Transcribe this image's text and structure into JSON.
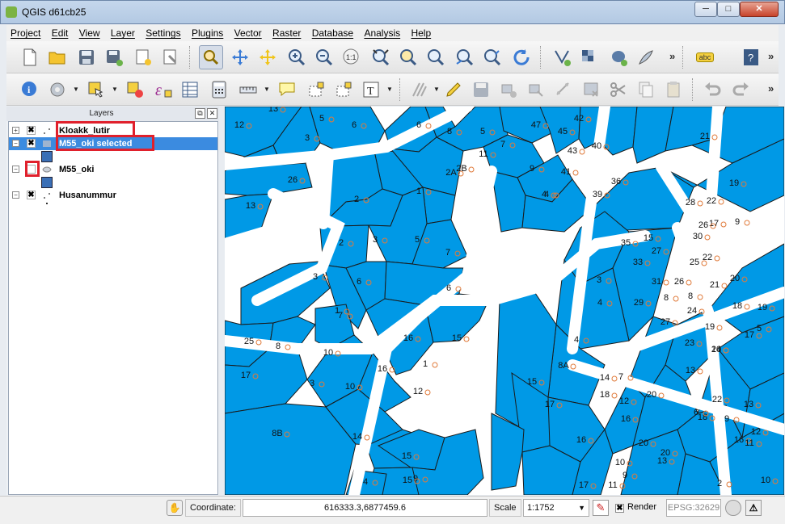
{
  "window": {
    "title": "QGIS d61cb25",
    "minimize": "─",
    "maximize": "□",
    "close": "✕"
  },
  "menubar": {
    "items": [
      "Project",
      "Edit",
      "View",
      "Layer",
      "Settings",
      "Plugins",
      "Vector",
      "Raster",
      "Database",
      "Analysis",
      "Help"
    ]
  },
  "toolbar1": {
    "buttons": [
      "new-project-icon",
      "open-project-icon",
      "save-project-icon",
      "save-as-icon",
      "new-print-composer-icon",
      "composer-manager-icon",
      "pan-icon",
      "pan-to-selection-icon",
      "zoom-in-icon",
      "zoom-out-icon",
      "zoom-native-icon",
      "zoom-full-icon",
      "zoom-to-selection-icon",
      "zoom-to-layer-icon",
      "zoom-last-icon",
      "zoom-next-icon",
      "refresh-icon",
      "add-vector-icon",
      "add-raster-icon",
      "add-postgis-icon",
      "add-spatialite-icon",
      "label-icon",
      "help-icon"
    ],
    "label_button_text": "abc",
    "overflow": "»"
  },
  "toolbar2": {
    "buttons": [
      "identify-icon",
      "action-icon",
      "select-icon",
      "deselect-icon",
      "expression-select-icon",
      "attribute-table-icon",
      "field-calculator-icon",
      "measure-icon",
      "annotation-icon",
      "text-annotation-icon",
      "toggle-editing-icon",
      "current-edits-icon",
      "save-edits-icon",
      "add-feature-icon",
      "move-feature-icon",
      "node-tool-icon",
      "delete-selected-icon",
      "cut-features-icon",
      "copy-features-icon",
      "paste-features-icon",
      "undo-icon",
      "redo-icon"
    ],
    "overflow": "»"
  },
  "layers_panel": {
    "title": "Layers",
    "float": "⧉",
    "close": "✕",
    "layers": [
      {
        "name": "Kloakk_lutir",
        "checked": true,
        "expander": "+"
      },
      {
        "name": "M55_oki selected",
        "checked": true,
        "expander": "−"
      },
      {
        "name": "M55_oki",
        "checked": false,
        "expander": "−"
      },
      {
        "name": "Husanummur",
        "checked": true,
        "expander": "−"
      }
    ],
    "check_mark": "✖"
  },
  "map": {
    "colors": {
      "parcel_fill": "#0099e6",
      "parcel_stroke": "#1a1a1a",
      "point": "#e07a3a",
      "background": "#ffffff"
    },
    "labels": [
      "13",
      "12",
      "5",
      "6",
      "3",
      "6",
      "47",
      "42",
      "5",
      "8",
      "11",
      "7",
      "45",
      "40",
      "2A",
      "2B",
      "9",
      "43",
      "36",
      "41",
      "4",
      "1",
      "26",
      "2",
      "13",
      "39",
      "21",
      "4",
      "19",
      "22",
      "3",
      "5",
      "7",
      "28",
      "17",
      "9",
      "26",
      "3",
      "35",
      "15",
      "30",
      "27",
      "33",
      "25",
      "22",
      "4",
      "3",
      "2",
      "6",
      "31",
      "26",
      "20",
      "6",
      "8",
      "29",
      "21",
      "8",
      "27",
      "18",
      "24",
      "1",
      "7",
      "15",
      "16",
      "25",
      "19",
      "19",
      "14",
      "8",
      "4",
      "23",
      "20",
      "17",
      "5",
      "10",
      "8A",
      "17",
      "14",
      "13",
      "12",
      "16",
      "7",
      "3",
      "1",
      "12",
      "10",
      "22",
      "13",
      "8B",
      "16",
      "15",
      "17",
      "18",
      "20",
      "18",
      "9",
      "20",
      "16",
      "11",
      "12",
      "14",
      "16",
      "10",
      "9",
      "6",
      "20",
      "15",
      "4",
      "13",
      "17",
      "9",
      "2",
      "11",
      "15",
      "10"
    ]
  },
  "statusbar": {
    "coordinate_label": "Coordinate:",
    "coordinate_value": "616333.3,6877459.6",
    "scale_label": "Scale",
    "scale_value": "1:1752",
    "render_label": "Render",
    "render_checked": "✖",
    "crs": "EPSG:32629"
  }
}
